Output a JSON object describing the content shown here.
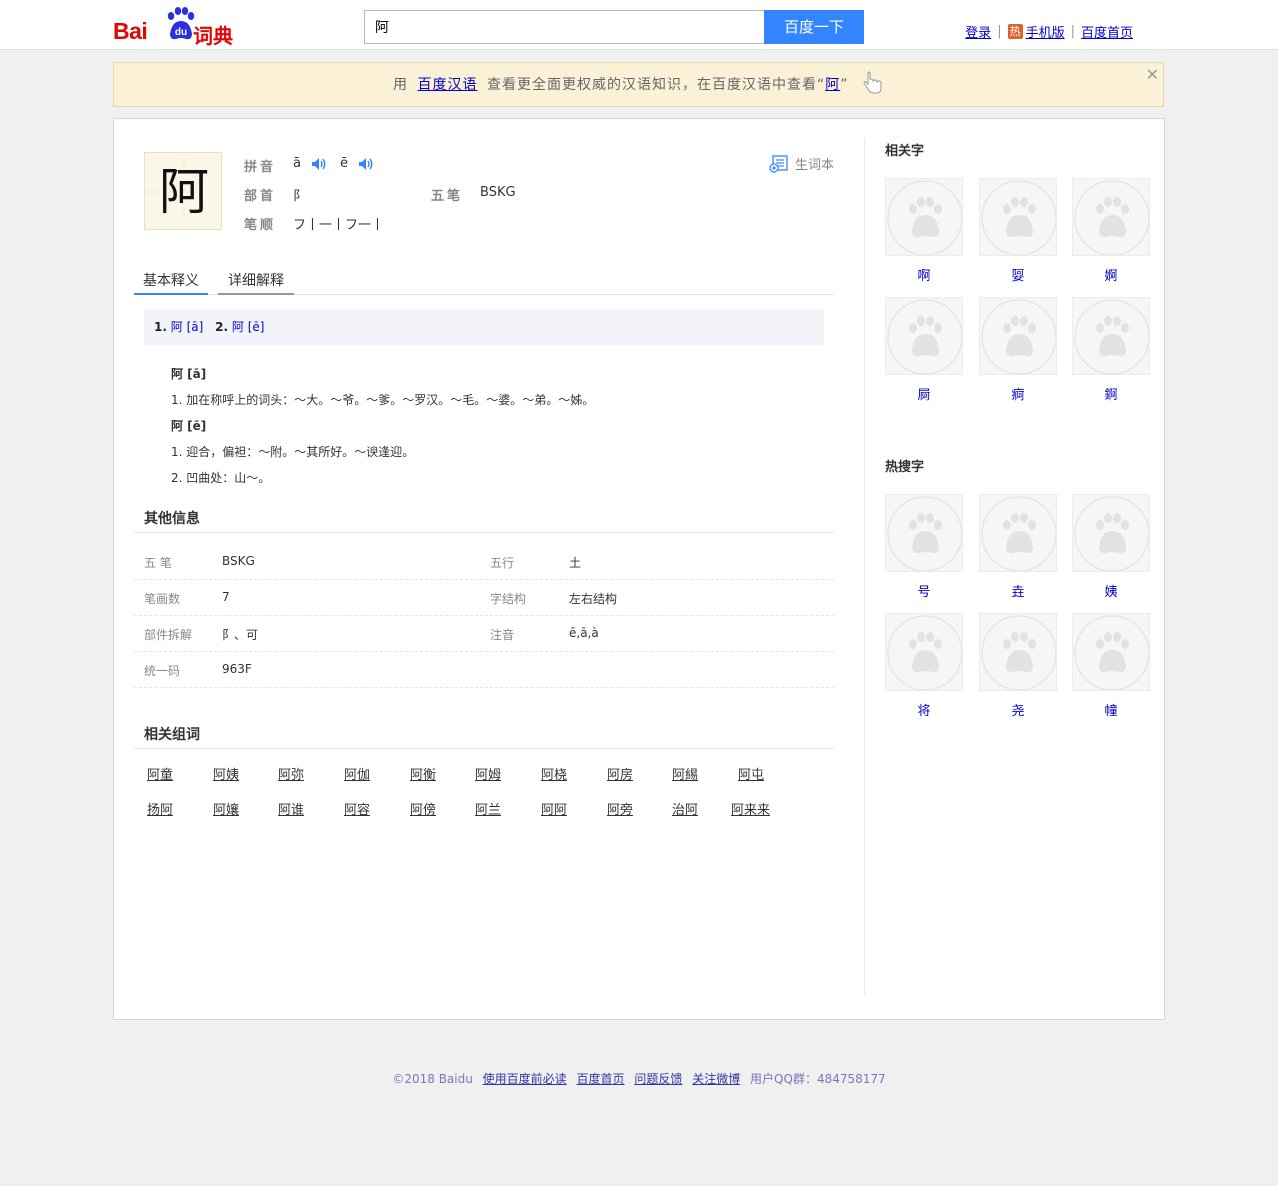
{
  "header": {
    "logo_text": "Bai",
    "logo_du": "du",
    "logo_suffix": "词典",
    "search_value": "阿",
    "search_button": "百度一下",
    "links": {
      "login": "登录",
      "hot_badge": "热",
      "mobile": "手机版",
      "baidu_home": "百度首页"
    }
  },
  "notice": {
    "prefix": "用",
    "link": "百度汉语",
    "middle": "查看更全面更权威的汉语知识，在百度汉语中查看",
    "quote_open": "“",
    "char_link": "阿",
    "quote_close": "”",
    "close": "✕"
  },
  "entry": {
    "char": "阿",
    "labels": {
      "pinyin": "拼音",
      "radical": "部首",
      "wubi": "五笔",
      "stroke_order": "笔顺"
    },
    "pinyin": [
      "ā",
      "ē"
    ],
    "radical": "阝",
    "wubi": "BSKG",
    "stroke_order": "フ丨一丨フ一丨",
    "vocab_label": "生词本"
  },
  "tabs": [
    "基本释义",
    "详细解释"
  ],
  "pronunciations": [
    {
      "num": "1.",
      "text": "阿 [ā]"
    },
    {
      "num": "2.",
      "text": "阿 [ē]"
    }
  ],
  "definitions": [
    {
      "type": "head",
      "text": "阿 [ā]"
    },
    {
      "type": "item",
      "text": "1. 加在称呼上的词头：～大。～爷。～爹。～罗汉。～毛。～婆。～弟。～姊。"
    },
    {
      "type": "head",
      "text": "阿 [ē]"
    },
    {
      "type": "item",
      "text": "1. 迎合，偏袒：～附。～其所好。～谀逢迎。"
    },
    {
      "type": "item",
      "text": "2. 凹曲处：山～。"
    }
  ],
  "other_info": {
    "title": "其他信息",
    "rows": [
      {
        "k1": "五 笔",
        "v1": "BSKG",
        "k2": "五行",
        "v2": "土"
      },
      {
        "k1": "笔画数",
        "v1": "7",
        "k2": "字结构",
        "v2": "左右结构"
      },
      {
        "k1": "部件拆解",
        "v1": "阝、可",
        "k2": "注音",
        "v2": "ē,ā,à"
      },
      {
        "k1": "统一码",
        "v1": "963F",
        "k2": "",
        "v2": ""
      }
    ]
  },
  "related_words": {
    "title": "相关组词",
    "words": [
      "阿童",
      "阿姨",
      "阿弥",
      "阿伽",
      "阿衡",
      "阿姆",
      "阿桡",
      "阿房",
      "阿緆",
      "阿屯",
      "扬阿",
      "阿孃",
      "阿谁",
      "阿容",
      "阿傍",
      "阿兰",
      "阿阿",
      "阿旁",
      "治阿",
      "阿来来"
    ]
  },
  "sidebar": {
    "related_title": "相关字",
    "related_chars": [
      "啊",
      "娿",
      "婀",
      "屙",
      "痾",
      "錒"
    ],
    "hot_title": "热搜字",
    "hot_chars": [
      "号",
      "垚",
      "姨",
      "将",
      "尧",
      "幢"
    ]
  },
  "footer": {
    "copyright": "©2018 Baidu",
    "links": [
      "使用百度前必读",
      "百度首页",
      "问题反馈",
      "关注微博"
    ],
    "qq": "用户QQ群：484758177"
  },
  "colors": {
    "brand_red": "#e10602",
    "search_blue": "#3385ff",
    "link": "#0000cc",
    "notice_bg": "#faf1d7"
  }
}
